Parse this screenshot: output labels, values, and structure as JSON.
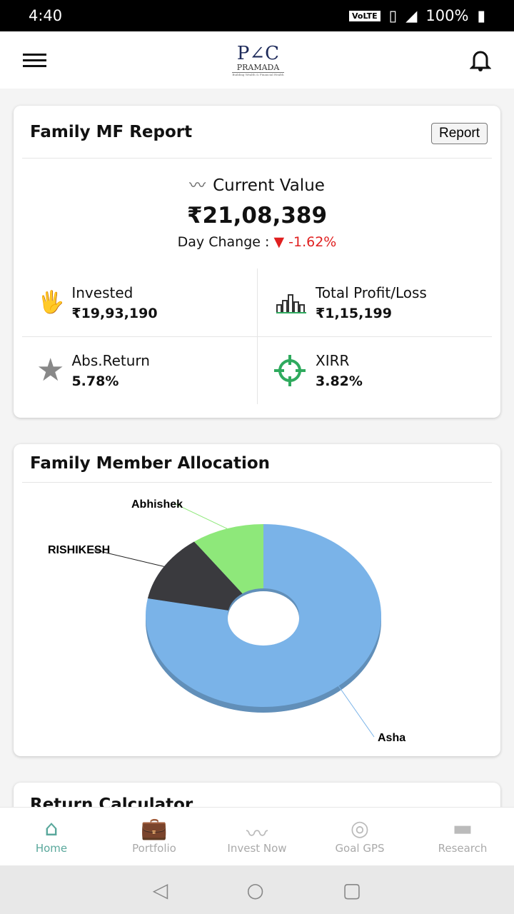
{
  "status": {
    "time": "4:40",
    "network": "VoLTE",
    "signal": "4G",
    "battery": "100%"
  },
  "header": {
    "logo_text": "PRAMADA",
    "logo_tagline": "Building Wealth & Financial Health",
    "menu_icon": "hamburger-icon",
    "bell_icon": "bell-icon"
  },
  "report_card": {
    "title": "Family MF Report",
    "report_button": "Report",
    "current_value_label": "Current Value",
    "current_value": "₹21,08,389",
    "day_change_label": "Day Change :",
    "day_change": "-1.62%",
    "neg_color": "#e02020",
    "stats": [
      {
        "label": "Invested",
        "value": "₹19,93,190"
      },
      {
        "label": "Total Profit/Loss",
        "value": "₹1,15,199"
      },
      {
        "label": "Abs.Return",
        "value": "5.78%"
      },
      {
        "label": "XIRR",
        "value": "3.82%"
      }
    ]
  },
  "allocation": {
    "title": "Family Member Allocation",
    "chart_data": {
      "type": "pie",
      "donut": true,
      "categories": [
        "Asha",
        "RISHIKESH",
        "Abhishek"
      ],
      "values": [
        78,
        12,
        10
      ],
      "colors": [
        "#7ab3e8",
        "#3a3a3e",
        "#8ee87a"
      ]
    }
  },
  "next_card": {
    "title": "Return Calculator"
  },
  "nav": [
    {
      "label": "Home",
      "active": true
    },
    {
      "label": "Portfolio"
    },
    {
      "label": "Invest Now"
    },
    {
      "label": "Goal GPS"
    },
    {
      "label": "Research"
    }
  ],
  "accent": "#5aa89c"
}
